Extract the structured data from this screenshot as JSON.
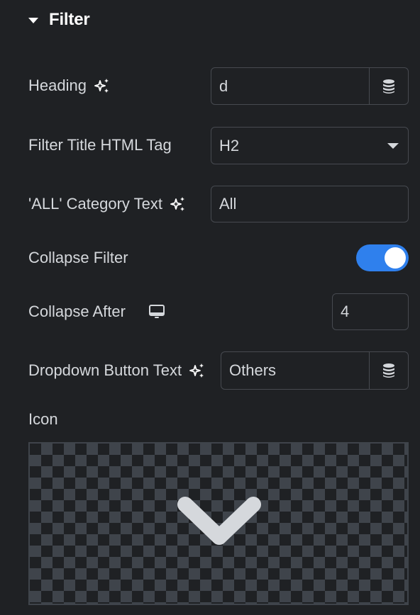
{
  "section": {
    "title": "Filter",
    "collapse_icon": "caret-down-icon"
  },
  "fields": {
    "heading": {
      "label": "Heading",
      "value": "d",
      "ai_icon": "sparkle-icon",
      "dynamic_icon": "database-icon"
    },
    "html_tag": {
      "label": "Filter Title HTML Tag",
      "selected": "H2",
      "dropdown_icon": "caret-down-icon"
    },
    "all_category": {
      "label": "'ALL' Category Text",
      "value": "All",
      "ai_icon": "sparkle-icon"
    },
    "collapse_filter": {
      "label": "Collapse Filter",
      "enabled": true,
      "color": "#2f80ed"
    },
    "collapse_after": {
      "label": "Collapse After",
      "value": "4",
      "device_icon": "desktop-monitor-icon"
    },
    "dropdown_button_text": {
      "label": "Dropdown Button Text",
      "value": "Others",
      "ai_icon": "sparkle-icon",
      "dynamic_icon": "database-icon"
    },
    "icon": {
      "label": "Icon",
      "preview_icon": "chevron-down-icon"
    }
  }
}
